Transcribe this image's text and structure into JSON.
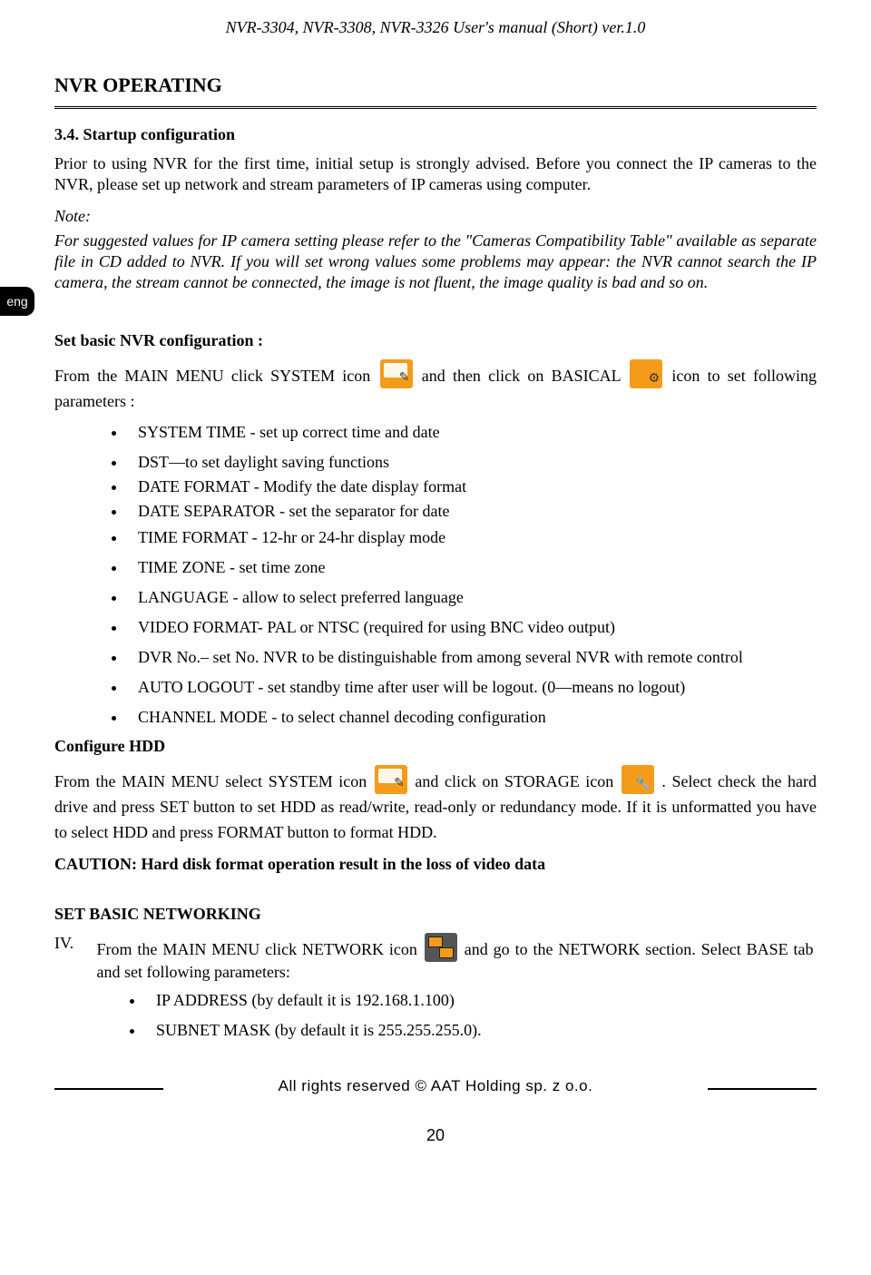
{
  "header": {
    "running_title": "NVR-3304, NVR-3308, NVR-3326  User's manual (Short) ver.1.0"
  },
  "tab": {
    "lang": "eng"
  },
  "section": {
    "title": "NVR OPERATING",
    "sub_num_title": "3.4. Startup configuration",
    "intro": "Prior to using NVR for the first time, initial setup is strongly advised. Before you connect the IP cameras to the NVR, please set up network and stream parameters of IP cameras using computer.",
    "note_label": "Note:",
    "note_body": "For suggested values for IP camera setting please refer to the \"Cameras Compatibility Table\" available as separate file in CD added to NVR. If you will set wrong values some problems may appear: the NVR cannot search the IP camera, the stream cannot be connected, the image is not fluent, the image quality is bad and so on.",
    "set_basic_title": "Set basic NVR configuration :",
    "set_basic_line_a": "From the MAIN MENU click  SYSTEM icon",
    "set_basic_line_b": "and then click on BASICAL",
    "set_basic_line_c": "icon to set following parameters :",
    "settings": [
      "SYSTEM TIME  - set up correct time and date",
      "DST—to set daylight saving functions",
      "DATE FORMAT - Modify the date display format",
      "DATE SEPARATOR - set the separator for date",
      "TIME FORMAT -  12-hr or 24-hr display mode",
      "TIME ZONE -  set time zone",
      "LANGUAGE - allow to select preferred language",
      "VIDEO FORMAT- PAL or NTSC (required for using BNC video output)",
      "DVR No.– set No. NVR to be distinguishable from among several NVR with remote control",
      "AUTO LOGOUT -   set standby time after user will be logout. (0—means no logout)",
      "CHANNEL MODE -  to select channel decoding  configuration"
    ],
    "configure_hdd_title": "Configure HDD",
    "hdd_a": "From the MAIN MENU select SYSTEM icon",
    "hdd_b": "and click on  STORAGE icon",
    "hdd_c": ". Select check the hard drive and press SET button to set HDD as read/write, read-only or redundancy mode. If it is unformatted you have to select HDD and press FORMAT button to format HDD.",
    "caution": "CAUTION: Hard disk format operation result in the loss of video data",
    "net_title": "SET BASIC NETWORKING",
    "net_roman": "IV.",
    "net_a": "From the MAIN MENU click NETWORK icon",
    "net_b": "and go to the NETWORK section.  Select BASE tab and set following parameters:",
    "net_settings": [
      "IP ADDRESS (by default it is 192.168.1.100)",
      "SUBNET MASK (by default it is 255.255.255.0)."
    ]
  },
  "footer": {
    "copyright": "All rights reserved © AAT Holding sp. z o.o.",
    "page_number": "20"
  }
}
